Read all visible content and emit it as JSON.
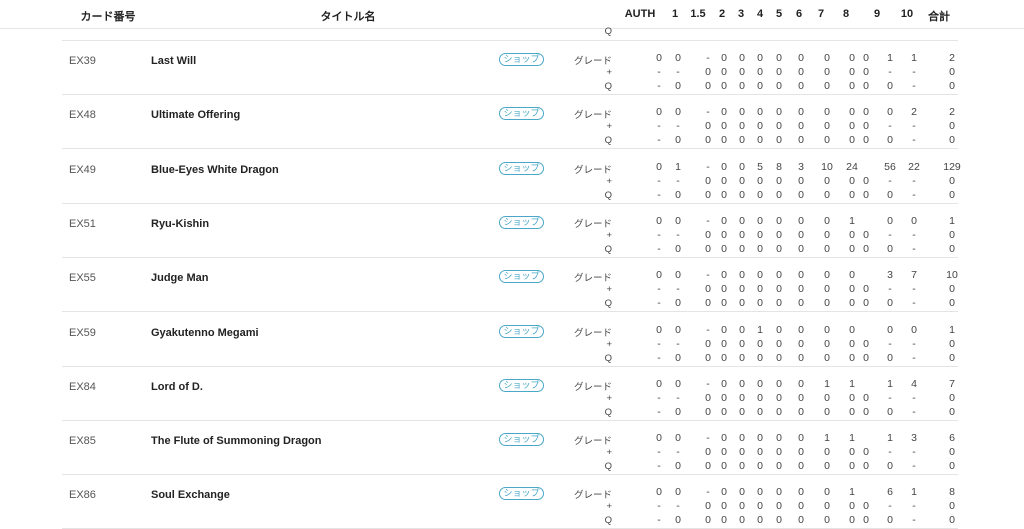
{
  "header": {
    "card_no": "カード番号",
    "title": "タイトル名",
    "cols": [
      "AUTH",
      "1",
      "1.5",
      "2",
      "3",
      "4",
      "5",
      "6",
      "7",
      "8",
      "9",
      "10",
      "合計"
    ]
  },
  "labels": {
    "grade": "グレード",
    "plus": "+",
    "q": "Q"
  },
  "shop_label": "ショップ",
  "top_partial": {
    "dashes": [
      "",
      "",
      "",
      "",
      "",
      "",
      "",
      "",
      "",
      "",
      "",
      "",
      "",
      ""
    ],
    "q": "Q"
  },
  "cards": [
    {
      "code": "EX39",
      "name": "Last Will",
      "grade": [
        "0",
        "0",
        "-",
        "0",
        "0",
        "0",
        "0",
        "0",
        "0",
        "0",
        "0",
        "1",
        "1",
        "2"
      ],
      "plus": [
        "-",
        "-",
        "0",
        "0",
        "0",
        "0",
        "0",
        "0",
        "0",
        "0",
        "0",
        "-",
        "-",
        "0"
      ],
      "q": [
        "-",
        "0",
        "0",
        "0",
        "0",
        "0",
        "0",
        "0",
        "0",
        "0",
        "0",
        "0",
        "-",
        "0"
      ]
    },
    {
      "code": "EX48",
      "name": "Ultimate Offering",
      "grade": [
        "0",
        "0",
        "-",
        "0",
        "0",
        "0",
        "0",
        "0",
        "0",
        "0",
        "0",
        "0",
        "2",
        "2"
      ],
      "plus": [
        "-",
        "-",
        "0",
        "0",
        "0",
        "0",
        "0",
        "0",
        "0",
        "0",
        "0",
        "-",
        "-",
        "0"
      ],
      "q": [
        "-",
        "0",
        "0",
        "0",
        "0",
        "0",
        "0",
        "0",
        "0",
        "0",
        "0",
        "0",
        "-",
        "0"
      ]
    },
    {
      "code": "EX49",
      "name": "Blue-Eyes White Dragon",
      "grade": [
        "0",
        "1",
        "-",
        "0",
        "0",
        "5",
        "8",
        "3",
        "10",
        "24",
        "",
        "56",
        "22",
        "129"
      ],
      "plus": [
        "-",
        "-",
        "0",
        "0",
        "0",
        "0",
        "0",
        "0",
        "0",
        "0",
        "0",
        "-",
        "-",
        "0"
      ],
      "q": [
        "-",
        "0",
        "0",
        "0",
        "0",
        "0",
        "0",
        "0",
        "0",
        "0",
        "0",
        "0",
        "-",
        "0"
      ]
    },
    {
      "code": "EX51",
      "name": "Ryu-Kishin",
      "grade": [
        "0",
        "0",
        "-",
        "0",
        "0",
        "0",
        "0",
        "0",
        "0",
        "1",
        "",
        "0",
        "0",
        "1"
      ],
      "plus": [
        "-",
        "-",
        "0",
        "0",
        "0",
        "0",
        "0",
        "0",
        "0",
        "0",
        "0",
        "-",
        "-",
        "0"
      ],
      "q": [
        "-",
        "0",
        "0",
        "0",
        "0",
        "0",
        "0",
        "0",
        "0",
        "0",
        "0",
        "0",
        "-",
        "0"
      ]
    },
    {
      "code": "EX55",
      "name": "Judge Man",
      "grade": [
        "0",
        "0",
        "-",
        "0",
        "0",
        "0",
        "0",
        "0",
        "0",
        "0",
        "",
        "3",
        "7",
        "10"
      ],
      "plus": [
        "-",
        "-",
        "0",
        "0",
        "0",
        "0",
        "0",
        "0",
        "0",
        "0",
        "0",
        "-",
        "-",
        "0"
      ],
      "q": [
        "-",
        "0",
        "0",
        "0",
        "0",
        "0",
        "0",
        "0",
        "0",
        "0",
        "0",
        "0",
        "-",
        "0"
      ]
    },
    {
      "code": "EX59",
      "name": "Gyakutenno Megami",
      "grade": [
        "0",
        "0",
        "-",
        "0",
        "0",
        "1",
        "0",
        "0",
        "0",
        "0",
        "",
        "0",
        "0",
        "1"
      ],
      "plus": [
        "-",
        "-",
        "0",
        "0",
        "0",
        "0",
        "0",
        "0",
        "0",
        "0",
        "0",
        "-",
        "-",
        "0"
      ],
      "q": [
        "-",
        "0",
        "0",
        "0",
        "0",
        "0",
        "0",
        "0",
        "0",
        "0",
        "0",
        "0",
        "-",
        "0"
      ]
    },
    {
      "code": "EX84",
      "name": "Lord of D.",
      "grade": [
        "0",
        "0",
        "-",
        "0",
        "0",
        "0",
        "0",
        "0",
        "1",
        "1",
        "",
        "1",
        "4",
        "7"
      ],
      "plus": [
        "-",
        "-",
        "0",
        "0",
        "0",
        "0",
        "0",
        "0",
        "0",
        "0",
        "0",
        "-",
        "-",
        "0"
      ],
      "q": [
        "-",
        "0",
        "0",
        "0",
        "0",
        "0",
        "0",
        "0",
        "0",
        "0",
        "0",
        "0",
        "-",
        "0"
      ]
    },
    {
      "code": "EX85",
      "name": "The Flute of Summoning Dragon",
      "grade": [
        "0",
        "0",
        "-",
        "0",
        "0",
        "0",
        "0",
        "0",
        "1",
        "1",
        "",
        "1",
        "3",
        "6"
      ],
      "plus": [
        "-",
        "-",
        "0",
        "0",
        "0",
        "0",
        "0",
        "0",
        "0",
        "0",
        "0",
        "-",
        "-",
        "0"
      ],
      "q": [
        "-",
        "0",
        "0",
        "0",
        "0",
        "0",
        "0",
        "0",
        "0",
        "0",
        "0",
        "0",
        "-",
        "0"
      ]
    },
    {
      "code": "EX86",
      "name": "Soul Exchange",
      "grade": [
        "0",
        "0",
        "-",
        "0",
        "0",
        "0",
        "0",
        "0",
        "0",
        "1",
        "",
        "6",
        "1",
        "8"
      ],
      "plus": [
        "-",
        "-",
        "0",
        "0",
        "0",
        "0",
        "0",
        "0",
        "0",
        "0",
        "0",
        "-",
        "-",
        "0"
      ],
      "q": [
        "-",
        "0",
        "0",
        "0",
        "0",
        "0",
        "0",
        "0",
        "0",
        "0",
        "0",
        "0",
        "-",
        "0"
      ]
    }
  ]
}
